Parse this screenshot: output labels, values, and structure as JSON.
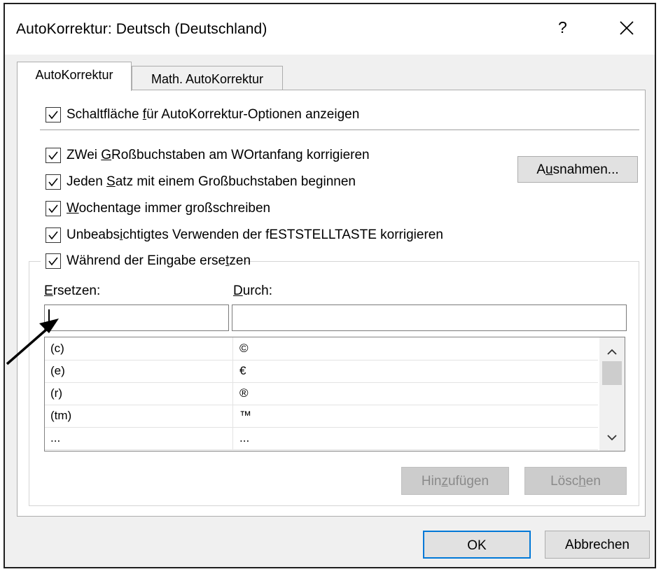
{
  "window": {
    "title": "AutoKorrektur: Deutsch (Deutschland)",
    "help_label": "?"
  },
  "tabs": [
    {
      "label": "AutoKorrektur"
    },
    {
      "label": "Math. AutoKorrektur"
    }
  ],
  "options": {
    "show_buttons": {
      "pre": "Schaltfläche ",
      "key": "f",
      "post": "ür AutoKorrektur-Optionen anzeigen"
    },
    "two_caps": {
      "pre": "ZWei ",
      "key": "G",
      "post": "Roßbuchstaben am WOrtanfang korrigieren"
    },
    "sentence_caps": {
      "pre": "Jeden ",
      "key": "S",
      "post": "atz mit einem Großbuchstaben beginnen"
    },
    "weekdays": {
      "pre": "",
      "key": "W",
      "post": "ochentage immer großschreiben"
    },
    "caps_lock": {
      "pre": "Unbeabs",
      "key": "i",
      "post": "chtigtes Verwenden der fESTSTELLTASTE korrigieren"
    },
    "replace_typing": {
      "pre": "Während der Eingabe erse",
      "key": "t",
      "post": "zen"
    }
  },
  "buttons": {
    "exceptions": {
      "pre": "A",
      "key": "u",
      "post": "snahmen..."
    },
    "add": {
      "pre": "Hin",
      "key": "z",
      "post": "ufügen"
    },
    "delete": {
      "pre": "Lösc",
      "key": "h",
      "post": "en"
    },
    "ok": "OK",
    "cancel": "Abbrechen"
  },
  "replace": {
    "replace_label": {
      "key": "E",
      "post": "rsetzen:"
    },
    "with_label": {
      "key": "D",
      "post": "urch:"
    },
    "rows": [
      {
        "from": "(c)",
        "to": "©"
      },
      {
        "from": "(e)",
        "to": "€"
      },
      {
        "from": "(r)",
        "to": "®"
      },
      {
        "from": "(tm)",
        "to": "™"
      },
      {
        "from": "...",
        "to": "..."
      }
    ]
  }
}
